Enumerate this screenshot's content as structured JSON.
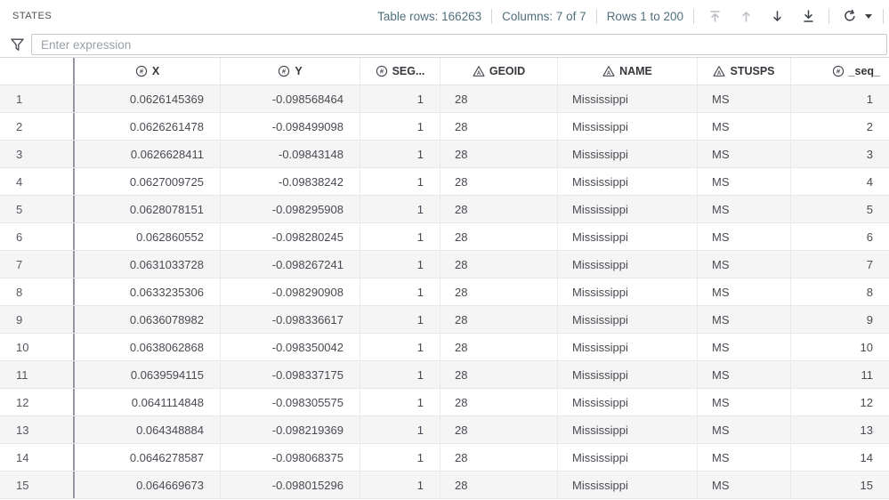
{
  "header_bar": {
    "dataset_name": "STATES",
    "table_rows": "Table rows: 166263",
    "columns_info": "Columns: 7 of 7",
    "rows_range": "Rows 1 to 200",
    "nav_icons": [
      {
        "icon": "jump-to-top-icon",
        "disabled": true
      },
      {
        "icon": "step-up-icon",
        "disabled": true
      },
      {
        "icon": "step-down-icon",
        "disabled": false
      },
      {
        "icon": "jump-to-bottom-icon",
        "disabled": false
      }
    ],
    "refresh_icon": "refresh-icon",
    "refresh_caret_icon": "chevron-down-icon"
  },
  "filter": {
    "funnel_icon": "filter-funnel-icon",
    "placeholder": "Enter expression"
  },
  "table": {
    "columns": [
      {
        "label": "X",
        "type": "numeric",
        "icon": "numeric-column-icon",
        "align": "right",
        "header_align": "center"
      },
      {
        "label": "Y",
        "type": "numeric",
        "icon": "numeric-column-icon",
        "align": "right",
        "header_align": "center"
      },
      {
        "label": "SEG...",
        "type": "numeric",
        "icon": "numeric-column-icon",
        "align": "right",
        "header_align": "center"
      },
      {
        "label": "GEOID",
        "type": "character",
        "icon": "character-column-icon",
        "align": "left",
        "header_align": "center"
      },
      {
        "label": "NAME",
        "type": "character",
        "icon": "character-column-icon",
        "align": "left",
        "header_align": "center"
      },
      {
        "label": "STUSPS",
        "type": "character",
        "icon": "character-column-icon",
        "align": "left",
        "header_align": "center"
      },
      {
        "label": "_seq_",
        "type": "numeric",
        "icon": "numeric-column-icon",
        "align": "right",
        "header_align": "right"
      }
    ],
    "rows": [
      {
        "n": "1",
        "cells": [
          "0.0626145369",
          "-0.098568464",
          "1",
          "28",
          "Mississippi",
          "MS",
          "1"
        ]
      },
      {
        "n": "2",
        "cells": [
          "0.0626261478",
          "-0.098499098",
          "1",
          "28",
          "Mississippi",
          "MS",
          "2"
        ]
      },
      {
        "n": "3",
        "cells": [
          "0.0626628411",
          "-0.09843148",
          "1",
          "28",
          "Mississippi",
          "MS",
          "3"
        ]
      },
      {
        "n": "4",
        "cells": [
          "0.0627009725",
          "-0.09838242",
          "1",
          "28",
          "Mississippi",
          "MS",
          "4"
        ]
      },
      {
        "n": "5",
        "cells": [
          "0.0628078151",
          "-0.098295908",
          "1",
          "28",
          "Mississippi",
          "MS",
          "5"
        ]
      },
      {
        "n": "6",
        "cells": [
          "0.062860552",
          "-0.098280245",
          "1",
          "28",
          "Mississippi",
          "MS",
          "6"
        ]
      },
      {
        "n": "7",
        "cells": [
          "0.0631033728",
          "-0.098267241",
          "1",
          "28",
          "Mississippi",
          "MS",
          "7"
        ]
      },
      {
        "n": "8",
        "cells": [
          "0.0633235306",
          "-0.098290908",
          "1",
          "28",
          "Mississippi",
          "MS",
          "8"
        ]
      },
      {
        "n": "9",
        "cells": [
          "0.0636078982",
          "-0.098336617",
          "1",
          "28",
          "Mississippi",
          "MS",
          "9"
        ]
      },
      {
        "n": "10",
        "cells": [
          "0.0638062868",
          "-0.098350042",
          "1",
          "28",
          "Mississippi",
          "MS",
          "10"
        ]
      },
      {
        "n": "11",
        "cells": [
          "0.0639594115",
          "-0.098337175",
          "1",
          "28",
          "Mississippi",
          "MS",
          "11"
        ]
      },
      {
        "n": "12",
        "cells": [
          "0.0641114848",
          "-0.098305575",
          "1",
          "28",
          "Mississippi",
          "MS",
          "12"
        ]
      },
      {
        "n": "13",
        "cells": [
          "0.064348884",
          "-0.098219369",
          "1",
          "28",
          "Mississippi",
          "MS",
          "13"
        ]
      },
      {
        "n": "14",
        "cells": [
          "0.0646278587",
          "-0.098068375",
          "1",
          "28",
          "Mississippi",
          "MS",
          "14"
        ]
      },
      {
        "n": "15",
        "cells": [
          "0.064669673",
          "-0.098015296",
          "1",
          "28",
          "Mississippi",
          "MS",
          "15"
        ]
      }
    ]
  },
  "colors": {
    "stats_text": "#50707e",
    "stripe": "#f5f5f6",
    "frozen_divider": "#9598a2",
    "grid_line": "#e7e7e9"
  }
}
